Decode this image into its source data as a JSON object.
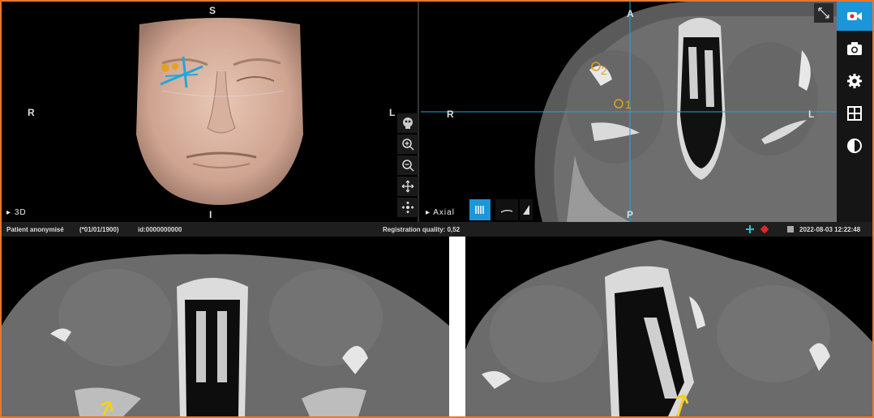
{
  "view3d": {
    "orient_top": "S",
    "orient_left": "R",
    "orient_right": "L",
    "orient_bottom": "I",
    "label": "3D",
    "tools": [
      "head-icon",
      "zoom-in-icon",
      "zoom-out-icon",
      "pan-icon",
      "center-icon"
    ]
  },
  "axial": {
    "orient_top": "A",
    "orient_left": "R",
    "orient_right": "L",
    "orient_bottom": "P",
    "label": "Axial",
    "points": [
      "2",
      "1"
    ]
  },
  "toolbar": {
    "items": [
      "record-icon",
      "camera-icon",
      "settings-icon",
      "layout-grid-icon",
      "contrast-icon"
    ]
  },
  "status": {
    "patient": "Patient anonymisé",
    "dob": "(*01/01/1900)",
    "id": "id:0000000000",
    "registration": "Registration quality: 0,52",
    "datetime": "2022-08-03 12:22:48"
  },
  "colors": {
    "frame": "#e8772e",
    "accent": "#1a96d9",
    "crosshair": "#21a7d8",
    "marker": "#e2a21c",
    "arrow": "#f5d020"
  }
}
